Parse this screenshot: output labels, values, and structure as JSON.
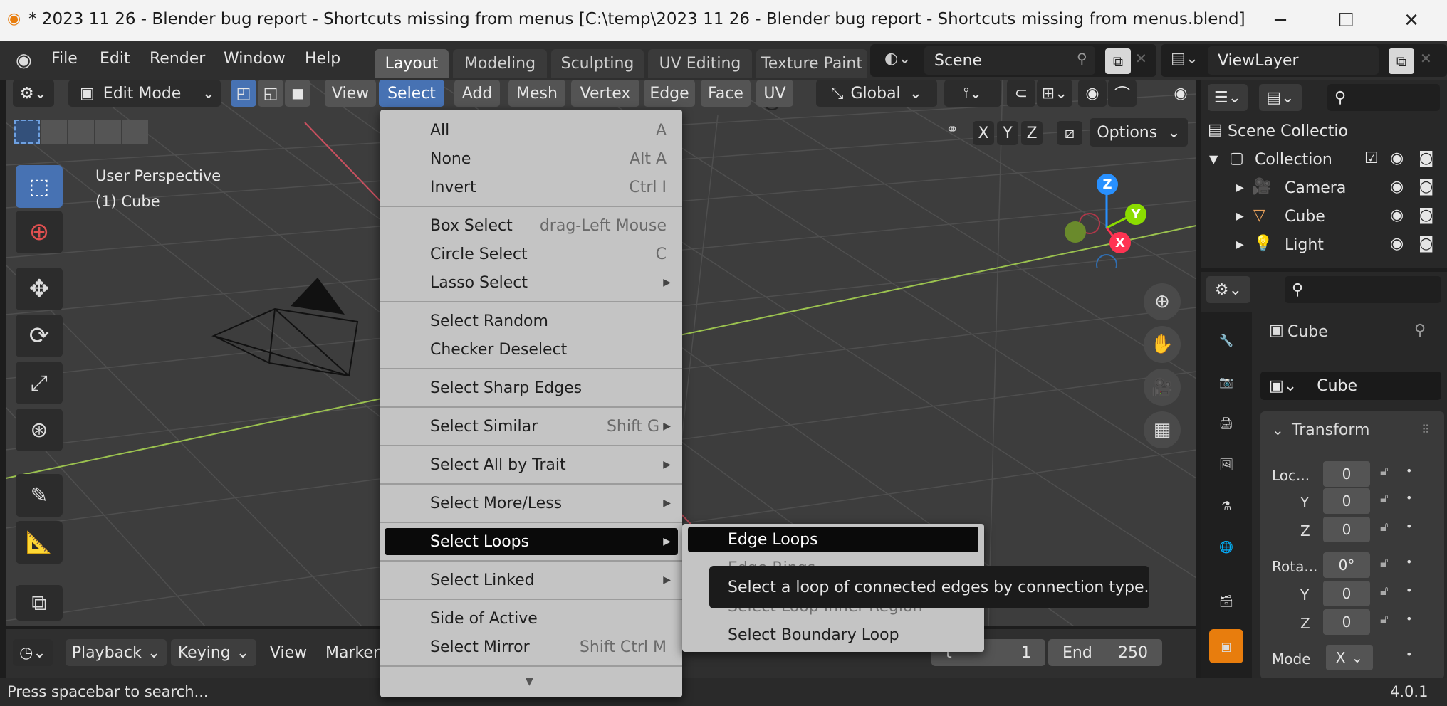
{
  "window": {
    "title": "* 2023 11 26 - Blender bug report - Shortcuts missing from menus [C:\\temp\\2023 11 26 - Blender bug report - Shortcuts missing from menus.blend] - Blender...",
    "minimize": "─",
    "maximize": "☐",
    "close": "✕"
  },
  "topbar": {
    "menus": [
      "File",
      "Edit",
      "Render",
      "Window",
      "Help"
    ],
    "workspaces": [
      "Layout",
      "Modeling",
      "Sculpting",
      "UV Editing",
      "Texture Paint"
    ],
    "scene": "Scene",
    "view_layer": "ViewLayer"
  },
  "viewport": {
    "mode": "Edit Mode",
    "header_menus": [
      "View",
      "Select",
      "Add",
      "Mesh",
      "Vertex",
      "Edge",
      "Face",
      "UV"
    ],
    "transform_orientation": "Global",
    "axis_x": "X",
    "axis_y": "Y",
    "axis_z": "Z",
    "options": "Options",
    "overlay_line1": "User Perspective",
    "overlay_line2": "(1) Cube",
    "gizmo": {
      "x": "X",
      "y": "Y",
      "z": "Z"
    }
  },
  "select_menu": {
    "groups": [
      [
        {
          "label": "All",
          "shortcut": "A"
        },
        {
          "label": "None",
          "shortcut": "Alt A"
        },
        {
          "label": "Invert",
          "shortcut": "Ctrl I"
        }
      ],
      [
        {
          "label": "Box Select",
          "shortcut": "drag-Left Mouse"
        },
        {
          "label": "Circle Select",
          "shortcut": "C"
        },
        {
          "label": "Lasso Select",
          "submenu": true
        }
      ],
      [
        {
          "label": "Select Random"
        },
        {
          "label": "Checker Deselect"
        }
      ],
      [
        {
          "label": "Select Sharp Edges"
        }
      ],
      [
        {
          "label": "Select Similar",
          "shortcut": "Shift G",
          "submenu": true
        }
      ],
      [
        {
          "label": "Select All by Trait",
          "submenu": true
        }
      ],
      [
        {
          "label": "Select More/Less",
          "submenu": true
        }
      ],
      [
        {
          "label": "Select Loops",
          "submenu": true,
          "highlighted": true
        }
      ],
      [
        {
          "label": "Select Linked",
          "submenu": true
        }
      ],
      [
        {
          "label": "Side of Active"
        },
        {
          "label": "Select Mirror",
          "shortcut": "Shift Ctrl M"
        }
      ]
    ],
    "more_arrow": "▼"
  },
  "loops_submenu": {
    "items": [
      "Edge Loops",
      "Edge Rings",
      "Select Loop Inner-Region",
      "Select Boundary Loop"
    ]
  },
  "tooltip": "Select a loop of connected edges by connection type.",
  "outliner": {
    "title": "Scene Collectio",
    "collection": "Collection",
    "objects": [
      "Camera",
      "Cube",
      "Light"
    ]
  },
  "properties": {
    "object_name": "Cube",
    "data_name": "Cube",
    "panel": "Transform",
    "location_label": "Loc...",
    "rotation_label": "Rota...",
    "y_label": "Y",
    "z_label": "Z",
    "loc": [
      "0",
      "0",
      "0"
    ],
    "rot": [
      "0°",
      "0",
      "0"
    ],
    "mode_label": "Mode",
    "mode_value": "X"
  },
  "timeline": {
    "playback": "Playback",
    "keying": "Keying",
    "view": "View",
    "marker": "Marker",
    "start_label": "t",
    "start_value": "1",
    "end_label": "End",
    "end_value": "250"
  },
  "status": {
    "hint": "Press spacebar to search...",
    "version": "4.0.1"
  },
  "colors": {
    "accent_blue": "#4772b3",
    "axis_x": "#ff3352",
    "axis_y": "#8bdc00",
    "axis_z": "#2890ff",
    "menu_bg": "#c4c4c4",
    "highlight": "#0a0a0a"
  }
}
